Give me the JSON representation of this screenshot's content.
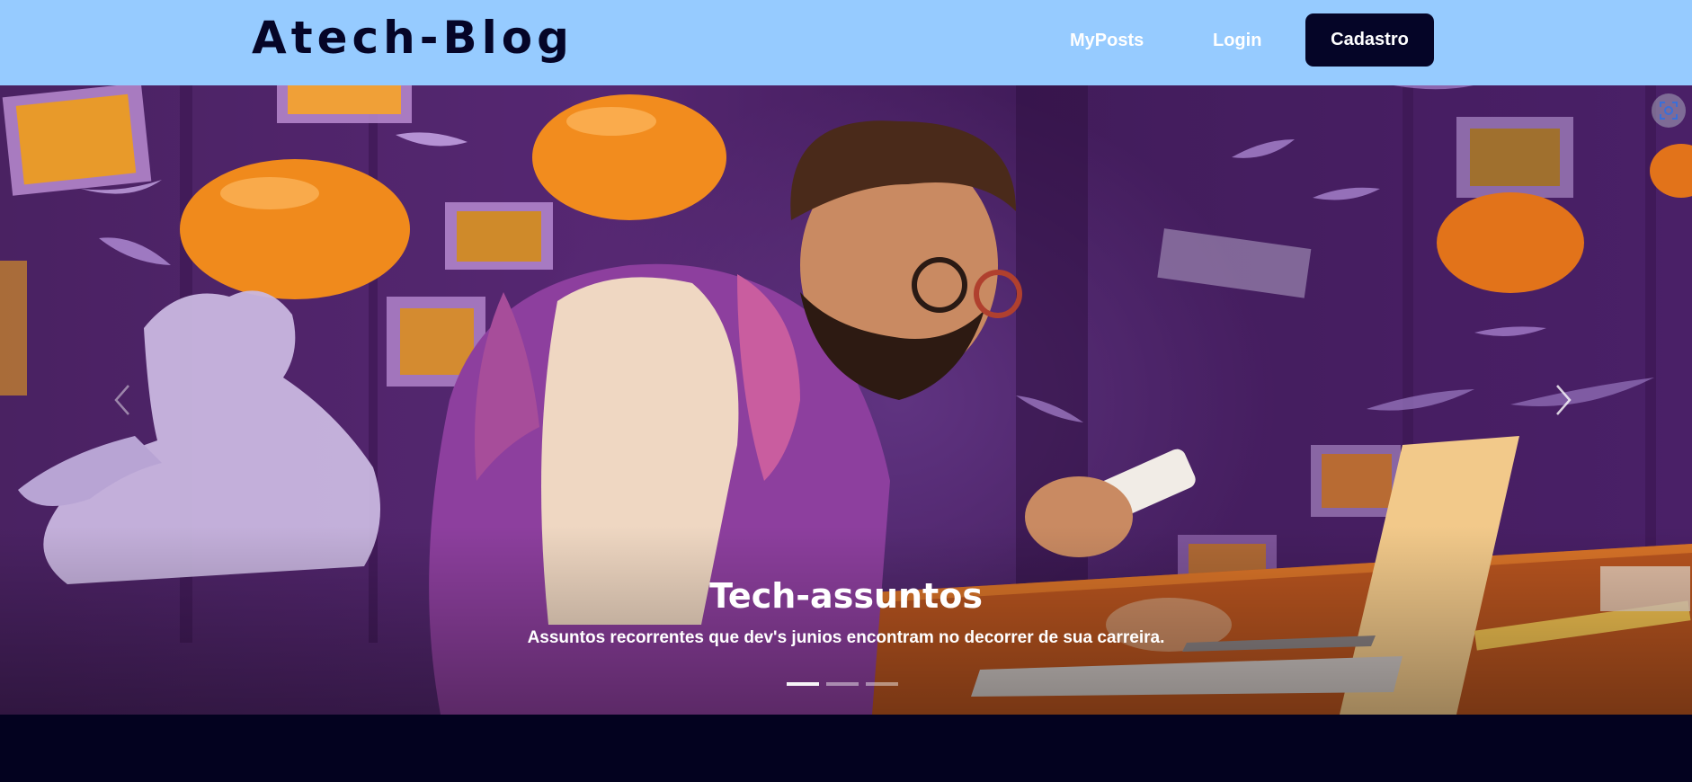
{
  "header": {
    "brand": "Atech-Blog",
    "nav": {
      "myposts_label": "MyPosts",
      "login_label": "Login",
      "signup_label": "Cadastro"
    }
  },
  "carousel": {
    "slide": {
      "title": "Tech-assuntos",
      "text": "Assuntos recorrentes que dev's junios encontram no decorrer de sua carreira.",
      "image_alt": "Illustration of a bearded developer with glasses using a phone and laptop in a purple room with orange balloons"
    },
    "indicators": 3,
    "active_indicator": 1,
    "prev_icon": "chevron-left-icon",
    "next_icon": "chevron-right-icon"
  },
  "overlay": {
    "icon": "visual-search-icon"
  },
  "colors": {
    "header_bg": "#96cbff",
    "brand": "#050527",
    "button_bg": "#050527",
    "page_bg": "#03021f",
    "hero_purple": "#5c2a78",
    "accent_orange": "#f08a1c"
  }
}
